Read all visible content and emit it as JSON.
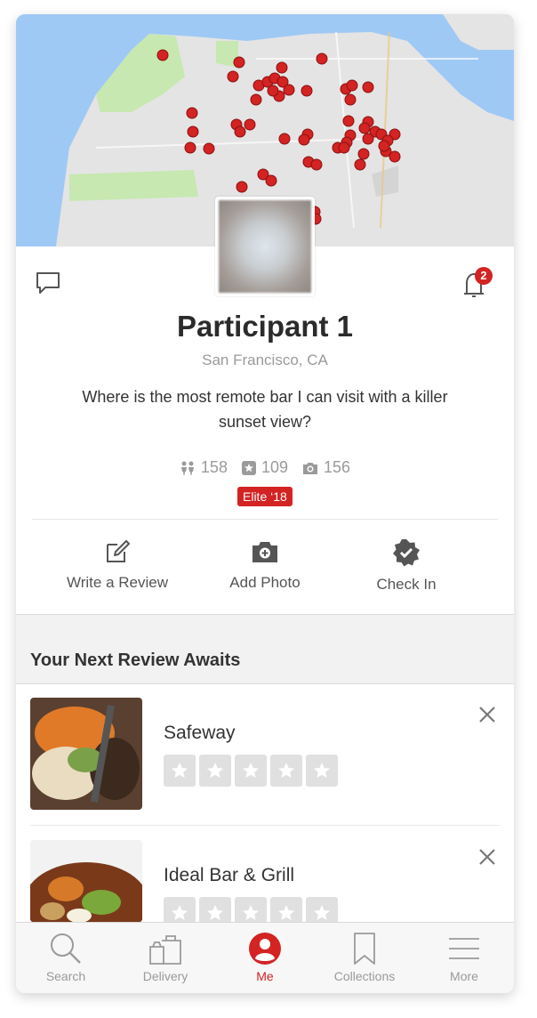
{
  "profile": {
    "name": "Participant 1",
    "location": "San Francisco, CA",
    "headline": "Where is the most remote bar I can visit with a killer sunset view?",
    "friends_count": "158",
    "reviews_count": "109",
    "photos_count": "156",
    "elite_badge": "Elite ‘18",
    "notification_count": "2"
  },
  "actions": [
    {
      "label": "Write a Review",
      "icon": "edit-icon"
    },
    {
      "label": "Add Photo",
      "icon": "camera-icon"
    },
    {
      "label": "Check In",
      "icon": "check-badge-icon"
    }
  ],
  "section": {
    "title": "Your Next Review Awaits"
  },
  "businesses": [
    {
      "name": "Safeway",
      "rating": 0
    },
    {
      "name": "Ideal Bar & Grill",
      "rating": 0
    }
  ],
  "tabs": [
    {
      "label": "Search",
      "icon": "search-icon"
    },
    {
      "label": "Delivery",
      "icon": "delivery-bag-icon"
    },
    {
      "label": "Me",
      "icon": "user-icon",
      "active": true
    },
    {
      "label": "Collections",
      "icon": "bookmark-icon"
    },
    {
      "label": "More",
      "icon": "menu-icon"
    }
  ],
  "colors": {
    "brand": "#d32323",
    "map_water": "#9fc9f5",
    "map_park": "#c7e8b0",
    "map_land": "#e5e5e5",
    "pin": "#d32323"
  }
}
